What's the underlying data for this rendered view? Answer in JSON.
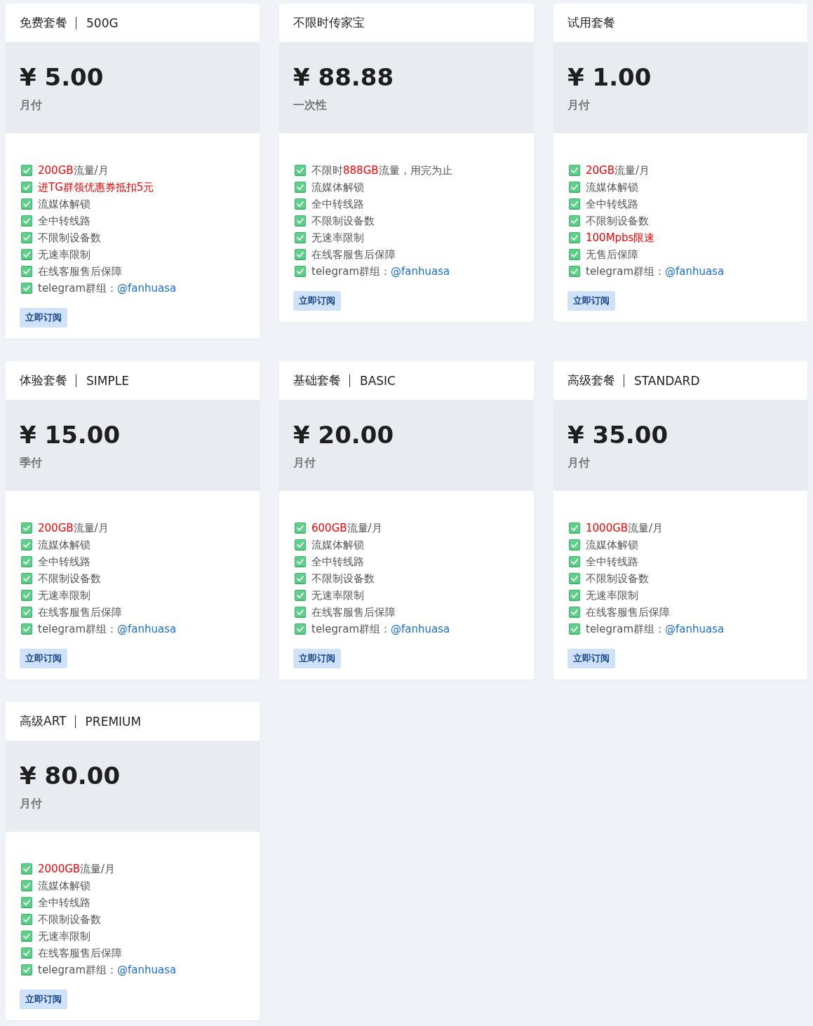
{
  "plans": [
    {
      "name": "免费套餐",
      "tier": "500G",
      "price": "¥ 5.00",
      "period": "月付",
      "features": [
        [
          {
            "text": "200GB",
            "kind": "highlight"
          },
          {
            "text": "流量/月",
            "kind": "plain"
          }
        ],
        [
          {
            "text": "进TG群领优惠券抵扣5元",
            "kind": "highlight"
          }
        ],
        [
          {
            "text": "流媒体解锁",
            "kind": "plain"
          }
        ],
        [
          {
            "text": "全中转线路",
            "kind": "plain"
          }
        ],
        [
          {
            "text": "不限制设备数",
            "kind": "plain"
          }
        ],
        [
          {
            "text": "无速率限制",
            "kind": "plain"
          }
        ],
        [
          {
            "text": "在线客服售后保障",
            "kind": "plain"
          }
        ],
        [
          {
            "text": "telegram群组：",
            "kind": "plain"
          },
          {
            "text": "@fanhuasa",
            "kind": "link"
          }
        ]
      ],
      "button": "立即订阅"
    },
    {
      "name": "不限时传家宝",
      "price": "¥ 88.88",
      "period": "一次性",
      "features": [
        [
          {
            "text": "不限时",
            "kind": "plain"
          },
          {
            "text": "888GB",
            "kind": "highlight"
          },
          {
            "text": "流量，用完为止",
            "kind": "plain"
          }
        ],
        [
          {
            "text": "流媒体解锁",
            "kind": "plain"
          }
        ],
        [
          {
            "text": "全中转线路",
            "kind": "plain"
          }
        ],
        [
          {
            "text": "不限制设备数",
            "kind": "plain"
          }
        ],
        [
          {
            "text": "无速率限制",
            "kind": "plain"
          }
        ],
        [
          {
            "text": "在线客服售后保障",
            "kind": "plain"
          }
        ],
        [
          {
            "text": "telegram群组：",
            "kind": "plain"
          },
          {
            "text": "@fanhuasa",
            "kind": "link"
          }
        ]
      ],
      "button": "立即订阅"
    },
    {
      "name": "试用套餐",
      "price": "¥ 1.00",
      "period": "月付",
      "features": [
        [
          {
            "text": "20GB",
            "kind": "highlight"
          },
          {
            "text": "流量/月",
            "kind": "plain"
          }
        ],
        [
          {
            "text": "流媒体解锁",
            "kind": "plain"
          }
        ],
        [
          {
            "text": "全中转线路",
            "kind": "plain"
          }
        ],
        [
          {
            "text": "不限制设备数",
            "kind": "plain"
          }
        ],
        [
          {
            "text": "100Mpbs限速",
            "kind": "highlight"
          }
        ],
        [
          {
            "text": "无售后保障",
            "kind": "plain"
          }
        ],
        [
          {
            "text": "telegram群组：",
            "kind": "plain"
          },
          {
            "text": "@fanhuasa",
            "kind": "link"
          }
        ]
      ],
      "button": "立即订阅"
    },
    {
      "name": "体验套餐",
      "tier": "SIMPLE",
      "price": "¥ 15.00",
      "period": "季付",
      "features": [
        [
          {
            "text": "200GB",
            "kind": "highlight"
          },
          {
            "text": "流量/月",
            "kind": "plain"
          }
        ],
        [
          {
            "text": "流媒体解锁",
            "kind": "plain"
          }
        ],
        [
          {
            "text": "全中转线路",
            "kind": "plain"
          }
        ],
        [
          {
            "text": "不限制设备数",
            "kind": "plain"
          }
        ],
        [
          {
            "text": "无速率限制",
            "kind": "plain"
          }
        ],
        [
          {
            "text": "在线客服售后保障",
            "kind": "plain"
          }
        ],
        [
          {
            "text": "telegram群组：",
            "kind": "plain"
          },
          {
            "text": "@fanhuasa",
            "kind": "link"
          }
        ]
      ],
      "button": "立即订阅"
    },
    {
      "name": "基础套餐",
      "tier": "BASIC",
      "price": "¥ 20.00",
      "period": "月付",
      "features": [
        [
          {
            "text": "600GB",
            "kind": "highlight"
          },
          {
            "text": "流量/月",
            "kind": "plain"
          }
        ],
        [
          {
            "text": "流媒体解锁",
            "kind": "plain"
          }
        ],
        [
          {
            "text": "全中转线路",
            "kind": "plain"
          }
        ],
        [
          {
            "text": "不限制设备数",
            "kind": "plain"
          }
        ],
        [
          {
            "text": "无速率限制",
            "kind": "plain"
          }
        ],
        [
          {
            "text": "在线客服售后保障",
            "kind": "plain"
          }
        ],
        [
          {
            "text": "telegram群组：",
            "kind": "plain"
          },
          {
            "text": "@fanhuasa",
            "kind": "link"
          }
        ]
      ],
      "button": "立即订阅"
    },
    {
      "name": "高级套餐",
      "tier": "STANDARD",
      "price": "¥ 35.00",
      "period": "月付",
      "features": [
        [
          {
            "text": "1000GB",
            "kind": "highlight"
          },
          {
            "text": "流量/月",
            "kind": "plain"
          }
        ],
        [
          {
            "text": "流媒体解锁",
            "kind": "plain"
          }
        ],
        [
          {
            "text": "全中转线路",
            "kind": "plain"
          }
        ],
        [
          {
            "text": "不限制设备数",
            "kind": "plain"
          }
        ],
        [
          {
            "text": "无速率限制",
            "kind": "plain"
          }
        ],
        [
          {
            "text": "在线客服售后保障",
            "kind": "plain"
          }
        ],
        [
          {
            "text": "telegram群组：",
            "kind": "plain"
          },
          {
            "text": "@fanhuasa",
            "kind": "link"
          }
        ]
      ],
      "button": "立即订阅"
    },
    {
      "name": "高级ART",
      "tier": "PREMIUM",
      "price": "¥ 80.00",
      "period": "月付",
      "features": [
        [
          {
            "text": "2000GB",
            "kind": "highlight"
          },
          {
            "text": "流量/月",
            "kind": "plain"
          }
        ],
        [
          {
            "text": "流媒体解锁",
            "kind": "plain"
          }
        ],
        [
          {
            "text": "全中转线路",
            "kind": "plain"
          }
        ],
        [
          {
            "text": "不限制设备数",
            "kind": "plain"
          }
        ],
        [
          {
            "text": "无速率限制",
            "kind": "plain"
          }
        ],
        [
          {
            "text": "在线客服售后保障",
            "kind": "plain"
          }
        ],
        [
          {
            "text": "telegram群组：",
            "kind": "plain"
          },
          {
            "text": "@fanhuasa",
            "kind": "link"
          }
        ]
      ],
      "button": "立即订阅"
    }
  ]
}
